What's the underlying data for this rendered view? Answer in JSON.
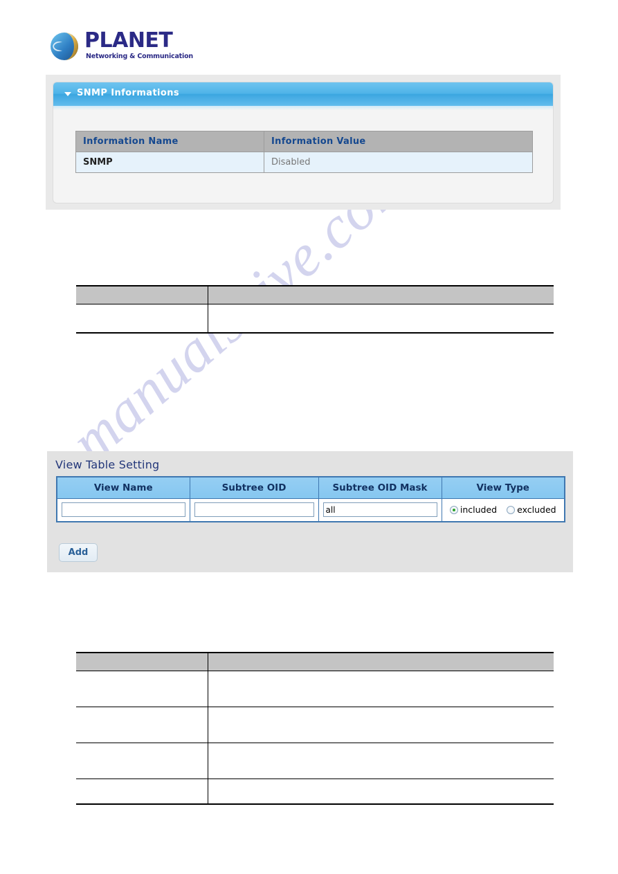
{
  "brand": {
    "name": "PLANET",
    "tagline": "Networking & Communication",
    "logo_icon": "planet-globe-icon",
    "word_color": "#2b2a86"
  },
  "watermark": {
    "text": "manualshive.com",
    "color": "#b9bbe4"
  },
  "snmp_panel": {
    "title": "SNMP Informations",
    "collapse_icon": "caret-down-icon",
    "header_color": "#4eb3e8",
    "table": {
      "headers": [
        "Information Name",
        "Information Value"
      ],
      "header_text_color": "#15488f",
      "header_bg": "#b3b3b3",
      "row_bg": "#e6f2fb",
      "rows": [
        {
          "name": "SNMP",
          "value": "Disabled"
        }
      ]
    }
  },
  "description_table_1": {
    "headers": [
      "",
      ""
    ],
    "rows": [
      [
        "",
        ""
      ]
    ]
  },
  "view_panel": {
    "title": "View Table Setting",
    "table": {
      "headers": [
        "View Name",
        "Subtree OID",
        "Subtree OID Mask",
        "View Type"
      ],
      "header_bg": "#8ac9f1",
      "header_text_color": "#123262",
      "border_color": "#3f77b0",
      "row": {
        "view_name": "",
        "view_name_placeholder": "",
        "subtree_oid": "",
        "subtree_oid_placeholder": "",
        "subtree_oid_mask": "all",
        "subtree_oid_mask_placeholder": "",
        "view_type_options": [
          "included",
          "excluded"
        ],
        "view_type_selected": "included"
      }
    },
    "add_label": "Add"
  },
  "description_table_2": {
    "headers": [
      "",
      ""
    ],
    "rows": [
      [
        "",
        ""
      ],
      [
        "",
        ""
      ],
      [
        "",
        ""
      ],
      [
        "",
        ""
      ]
    ]
  }
}
